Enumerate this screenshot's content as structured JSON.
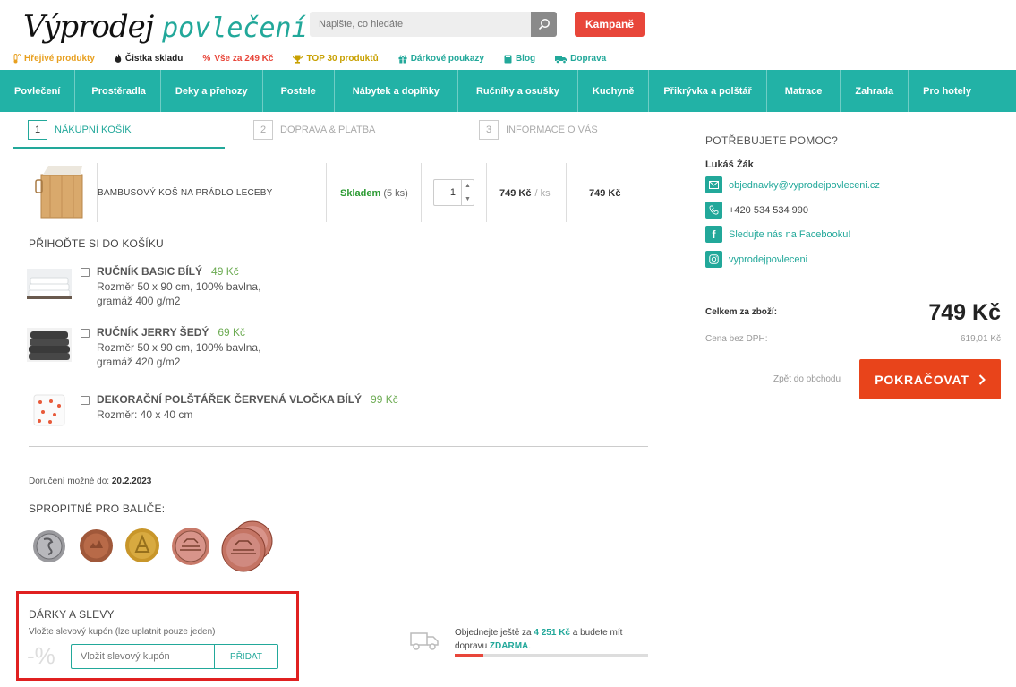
{
  "header": {
    "logo_main": "Výprodej",
    "logo_accent": "povlečení",
    "search_placeholder": "Napište, co hledáte",
    "campaign_label": "Kampaně"
  },
  "topnav": [
    {
      "label": "Hřejivé produkty",
      "icon": "thermometer-icon",
      "color": "#e8a020"
    },
    {
      "label": "Čistka skladu",
      "icon": "flame-icon",
      "color": "#222222"
    },
    {
      "label": "Vše za 249 Kč",
      "icon": "percent-icon",
      "color": "#e8463a"
    },
    {
      "label": "TOP 30 produktů",
      "icon": "trophy-icon",
      "color": "#c8a000"
    },
    {
      "label": "Dárkové poukazy",
      "icon": "gift-icon",
      "color": "#22a89a"
    },
    {
      "label": "Blog",
      "icon": "book-icon",
      "color": "#22a89a"
    },
    {
      "label": "Doprava",
      "icon": "truck-icon",
      "color": "#22a89a"
    }
  ],
  "mainnav": [
    "Povlečení",
    "Prostěradla",
    "Deky a přehozy",
    "Postele",
    "Nábytek a doplňky",
    "Ručníky a osušky",
    "Kuchyně",
    "Přikrývka a polštář",
    "Matrace",
    "Zahrada",
    "Pro hotely"
  ],
  "steps": [
    {
      "num": "1",
      "label": "NÁKUPNÍ KOŠÍK"
    },
    {
      "num": "2",
      "label": "DOPRAVA & PLATBA"
    },
    {
      "num": "3",
      "label": "INFORMACE O VÁS"
    }
  ],
  "cart_item": {
    "name": "BAMBUSOVÝ KOŠ NA PRÁDLO LECEBY",
    "stock_label": "Skladem",
    "stock_count": "(5 ks)",
    "quantity": "1",
    "unit_price": "749 Kč",
    "unit_suffix": "/ ks",
    "total_price": "749 Kč"
  },
  "addons": {
    "heading": "PŘIHOĎTE SI DO KOŠÍKU",
    "items": [
      {
        "title": "RUČNÍK BASIC BÍLÝ",
        "price": "49 Kč",
        "line1": "Rozměr 50 x 90 cm, 100% bavlna,",
        "line2": "gramáž 400 g/m2"
      },
      {
        "title": "RUČNÍK JERRY ŠEDÝ",
        "price": "69 Kč",
        "line1": "Rozměr 50 x 90 cm, 100% bavlna,",
        "line2": "gramáž 420 g/m2"
      },
      {
        "title": "DEKORAČNÍ POLŠTÁŘEK ČERVENÁ VLOČKA BÍLÝ",
        "price": "99 Kč",
        "line1": "Rozměr: 40 x 40 cm",
        "line2": ""
      }
    ]
  },
  "delivery": {
    "label": "Doručení možné do:",
    "date": "20.2.2023"
  },
  "tip": {
    "heading": "SPROPITNÉ PRO BALIČE:"
  },
  "coupon": {
    "heading": "DÁRKY A SLEVY",
    "subtitle": "Vložte slevový kupón (lze uplatnit pouze jeden)",
    "percent": "-%",
    "placeholder": "Vložit slevový kupón",
    "button": "PŘIDAT"
  },
  "shipping": {
    "pre": "Objednejte ještě za",
    "amount": "4 251 Kč",
    "mid": "a budete mít",
    "line2_pre": "dopravu",
    "free": "ZDARMA",
    "end": ".",
    "progress": 0.15
  },
  "help": {
    "heading": "POTŘEBUJETE POMOC?",
    "person": "Lukáš Žák",
    "email": "objednavky@vyprodejpovleceni.cz",
    "phone": "+420 534 534 990",
    "facebook": "Sledujte nás na Facebooku!",
    "instagram": "vyprodejpovleceni"
  },
  "summary": {
    "total_label": "Celkem za zboží:",
    "total_value": "749 Kč",
    "vat_label": "Cena bez DPH:",
    "vat_value": "619,01 Kč",
    "back_label": "Zpět do obchodu",
    "continue_label": "POKRAČOVAT"
  },
  "colors": {
    "accent": "#22a89a",
    "nav": "#22b2a6",
    "cta": "#e8441b",
    "highlight_box": "#e02020"
  }
}
